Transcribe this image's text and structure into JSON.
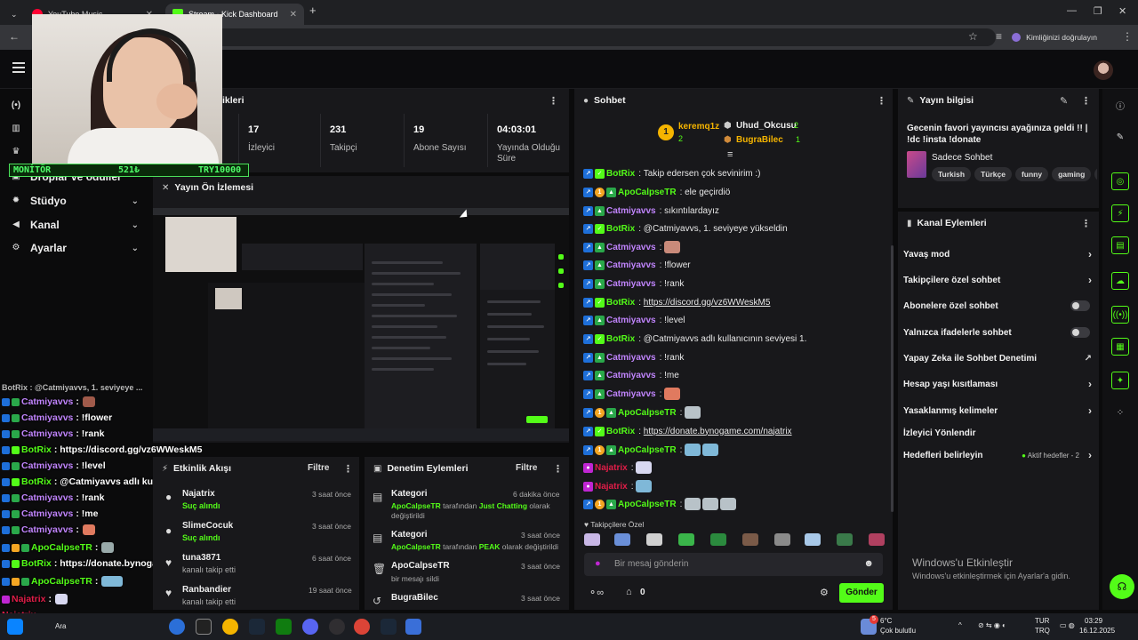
{
  "browser": {
    "tabs": [
      {
        "label": "YouTube Music"
      },
      {
        "label": "Stream - Kick Dashboard"
      }
    ],
    "new_tab": "+",
    "profile_label": "Kimliğinizi doğrulayın"
  },
  "overlay": {
    "monitor_label": "MONİTÖR",
    "monitor_value1": "521₺",
    "monitor_value2": "TRY10000"
  },
  "sidebar": {
    "items": [
      {
        "label": "Droplar ve ödüller",
        "icon": "trophy-icon"
      },
      {
        "label": "Stüdyo",
        "icon": "gear-icon"
      },
      {
        "label": "Kanal",
        "icon": "megaphone-icon"
      },
      {
        "label": "Ayarlar",
        "icon": "gear-icon"
      }
    ]
  },
  "stats": {
    "title": "ikleri",
    "items": [
      {
        "value": "17",
        "label": "İzleyici"
      },
      {
        "value": "231",
        "label": "Takipçi"
      },
      {
        "value": "19",
        "label": "Abone Sayısı"
      },
      {
        "value": "04:03:01",
        "label": "Yayında Olduğu Süre"
      }
    ]
  },
  "preview": {
    "title": "Yayın Ön İzlemesi"
  },
  "activity": {
    "title": "Etkinlik Akışı",
    "filter": "Filtre",
    "items": [
      {
        "name": "Najatrix",
        "detail": "Suç alındı",
        "time": "3 saat önce"
      },
      {
        "name": "SlimeCocuk",
        "detail": "Suç alındı",
        "time": "3 saat önce"
      },
      {
        "name": "tuna3871",
        "detail": "kanalı takip etti",
        "time": "6 saat önce"
      },
      {
        "name": "Ranbandier",
        "detail": "kanalı takip etti",
        "time": "19 saat önce"
      }
    ]
  },
  "moderation": {
    "title": "Denetim Eylemleri",
    "filter": "Filtre",
    "items": [
      {
        "title": "Kategori",
        "time": "6 dakika önce",
        "actor": "ApoCalpseTR",
        "mid": " tarafından ",
        "target": "Just Chatting",
        "end": " olarak değiştirildi"
      },
      {
        "title": "Kategori",
        "time": "3 saat önce",
        "actor": "ApoCalpseTR",
        "mid": " tarafından ",
        "target": "PEAK",
        "end": " olarak değiştirildi"
      },
      {
        "title": "ApoCalpseTR",
        "time": "3 saat önce",
        "detail": "bir mesajı sildi"
      },
      {
        "title": "BugraBilec",
        "time": "3 saat önce",
        "detail": ""
      }
    ]
  },
  "chat": {
    "title": "Sohbet",
    "leaders": [
      {
        "name": "keremq1z",
        "count": "2",
        "rank": "1"
      },
      {
        "name": "Uhud_Okcusu",
        "count": "2"
      },
      {
        "name": "BugraBilec",
        "count": "1"
      }
    ],
    "messages": [
      {
        "user": "BotRix",
        "color": "#53fc18",
        "text": "Takip edersen çok sevinirim :)"
      },
      {
        "user": "ApoCalpseTR",
        "color": "#53fc18",
        "text": "ele geçirdiö"
      },
      {
        "user": "Catmiyavvs",
        "color": "#c084fc",
        "text": "sıkıntılardayız"
      },
      {
        "user": "BotRix",
        "color": "#53fc18",
        "text": "@Catmiyavvs, 1. seviyeye yükseldin"
      },
      {
        "user": "Catmiyavvs",
        "color": "#c084fc",
        "text": ""
      },
      {
        "user": "Catmiyavvs",
        "color": "#c084fc",
        "text": "!flower"
      },
      {
        "user": "Catmiyavvs",
        "color": "#c084fc",
        "text": "!rank"
      },
      {
        "user": "BotRix",
        "color": "#53fc18",
        "text": "https://discord.gg/vz6WWeskM5"
      },
      {
        "user": "Catmiyavvs",
        "color": "#c084fc",
        "text": "!level"
      },
      {
        "user": "BotRix",
        "color": "#53fc18",
        "text": "@Catmiyavvs adlı kullanıcının seviyesi 1."
      },
      {
        "user": "Catmiyavvs",
        "color": "#c084fc",
        "text": "!rank"
      },
      {
        "user": "Catmiyavvs",
        "color": "#c084fc",
        "text": "!me"
      },
      {
        "user": "Catmiyavvs",
        "color": "#c084fc",
        "text": ""
      },
      {
        "user": "ApoCalpseTR",
        "color": "#53fc18",
        "text": ""
      },
      {
        "user": "BotRix",
        "color": "#53fc18",
        "text": "https://donate.bynogame.com/najatrix"
      },
      {
        "user": "ApoCalpseTR",
        "color": "#53fc18",
        "text": ""
      },
      {
        "user": "Najatrix",
        "color": "#e11d48",
        "text": ""
      },
      {
        "user": "Najatrix",
        "color": "#e11d48",
        "text": ""
      },
      {
        "user": "ApoCalpseTR",
        "color": "#53fc18",
        "text": ""
      }
    ],
    "followers_label": "Takipçilere Özel",
    "input_placeholder": "Bir mesaj gönderin",
    "points": "0",
    "send": "Gönder"
  },
  "stream_info": {
    "title": "Yayın bilgisi",
    "stream_title": "Gecenin favori yayıncısı ayağınıza geldi !! | !dc !insta !donate",
    "category": "Sadece Sohbet",
    "tags": [
      "Turkish",
      "Türkçe",
      "funny",
      "gaming"
    ]
  },
  "channel_actions": {
    "title": "Kanal Eylemleri",
    "items": [
      {
        "label": "Yavaş mod",
        "kind": "arrow"
      },
      {
        "label": "Takipçilere özel sohbet",
        "kind": "arrow"
      },
      {
        "label": "Abonelere özel sohbet",
        "kind": "toggle"
      },
      {
        "label": "Yalnızca ifadelerle sohbet",
        "kind": "toggle"
      },
      {
        "label": "Yapay Zeka ile Sohbet Denetimi",
        "kind": "external"
      },
      {
        "label": "Hesap yaşı kısıtlaması",
        "kind": "arrow"
      },
      {
        "label": "Yasaklanmış kelimeler",
        "kind": "arrow"
      },
      {
        "label": "İzleyici Yönlendir",
        "kind": "none"
      },
      {
        "label": "Hedefleri belirleyin",
        "kind": "arrow"
      }
    ],
    "goals_status": "Aktif hedefler - 2"
  },
  "watermark": {
    "title": "Windows'u Etkinleştir",
    "sub": "Windows'u etkinleştirmek için Ayarlar'a gidin."
  },
  "overlay_chat": [
    {
      "user": "Catmiyavvs",
      "text": ""
    },
    {
      "user": "Catmiyavvs",
      "text": ": !flower"
    },
    {
      "user": "Catmiyavvs",
      "text": ": !rank"
    },
    {
      "user": "BotRix",
      "text": ": https://discord.gg/vz6WWeskM5"
    },
    {
      "user": "Catmiyavvs",
      "text": ": !level"
    },
    {
      "user": "BotRix",
      "text": ": @Catmiyavvs adlı kullanıcının seviyesi 1."
    },
    {
      "user": "Catmiyavvs",
      "text": ": !rank"
    },
    {
      "user": "Catmiyavvs",
      "text": ": !me"
    },
    {
      "user": "Catmiyavvs",
      "text": ""
    },
    {
      "user": "ApoCalpseTR",
      "text": ""
    },
    {
      "user": "BotRix",
      "text": ": https://donate.bynogame.com/najatrix"
    },
    {
      "user": "ApoCalpseTR",
      "text": ""
    },
    {
      "user": "Najatrix",
      "text": ""
    },
    {
      "user": "Najatrix",
      "text": ""
    }
  ],
  "taskbar": {
    "search": "Ara",
    "weather_temp": "6°C",
    "weather_desc": "Çok bulutlu",
    "lang1": "TUR",
    "lang2": "TRQ",
    "time": "03:29",
    "date": "16.12.2025",
    "notif": "5"
  }
}
